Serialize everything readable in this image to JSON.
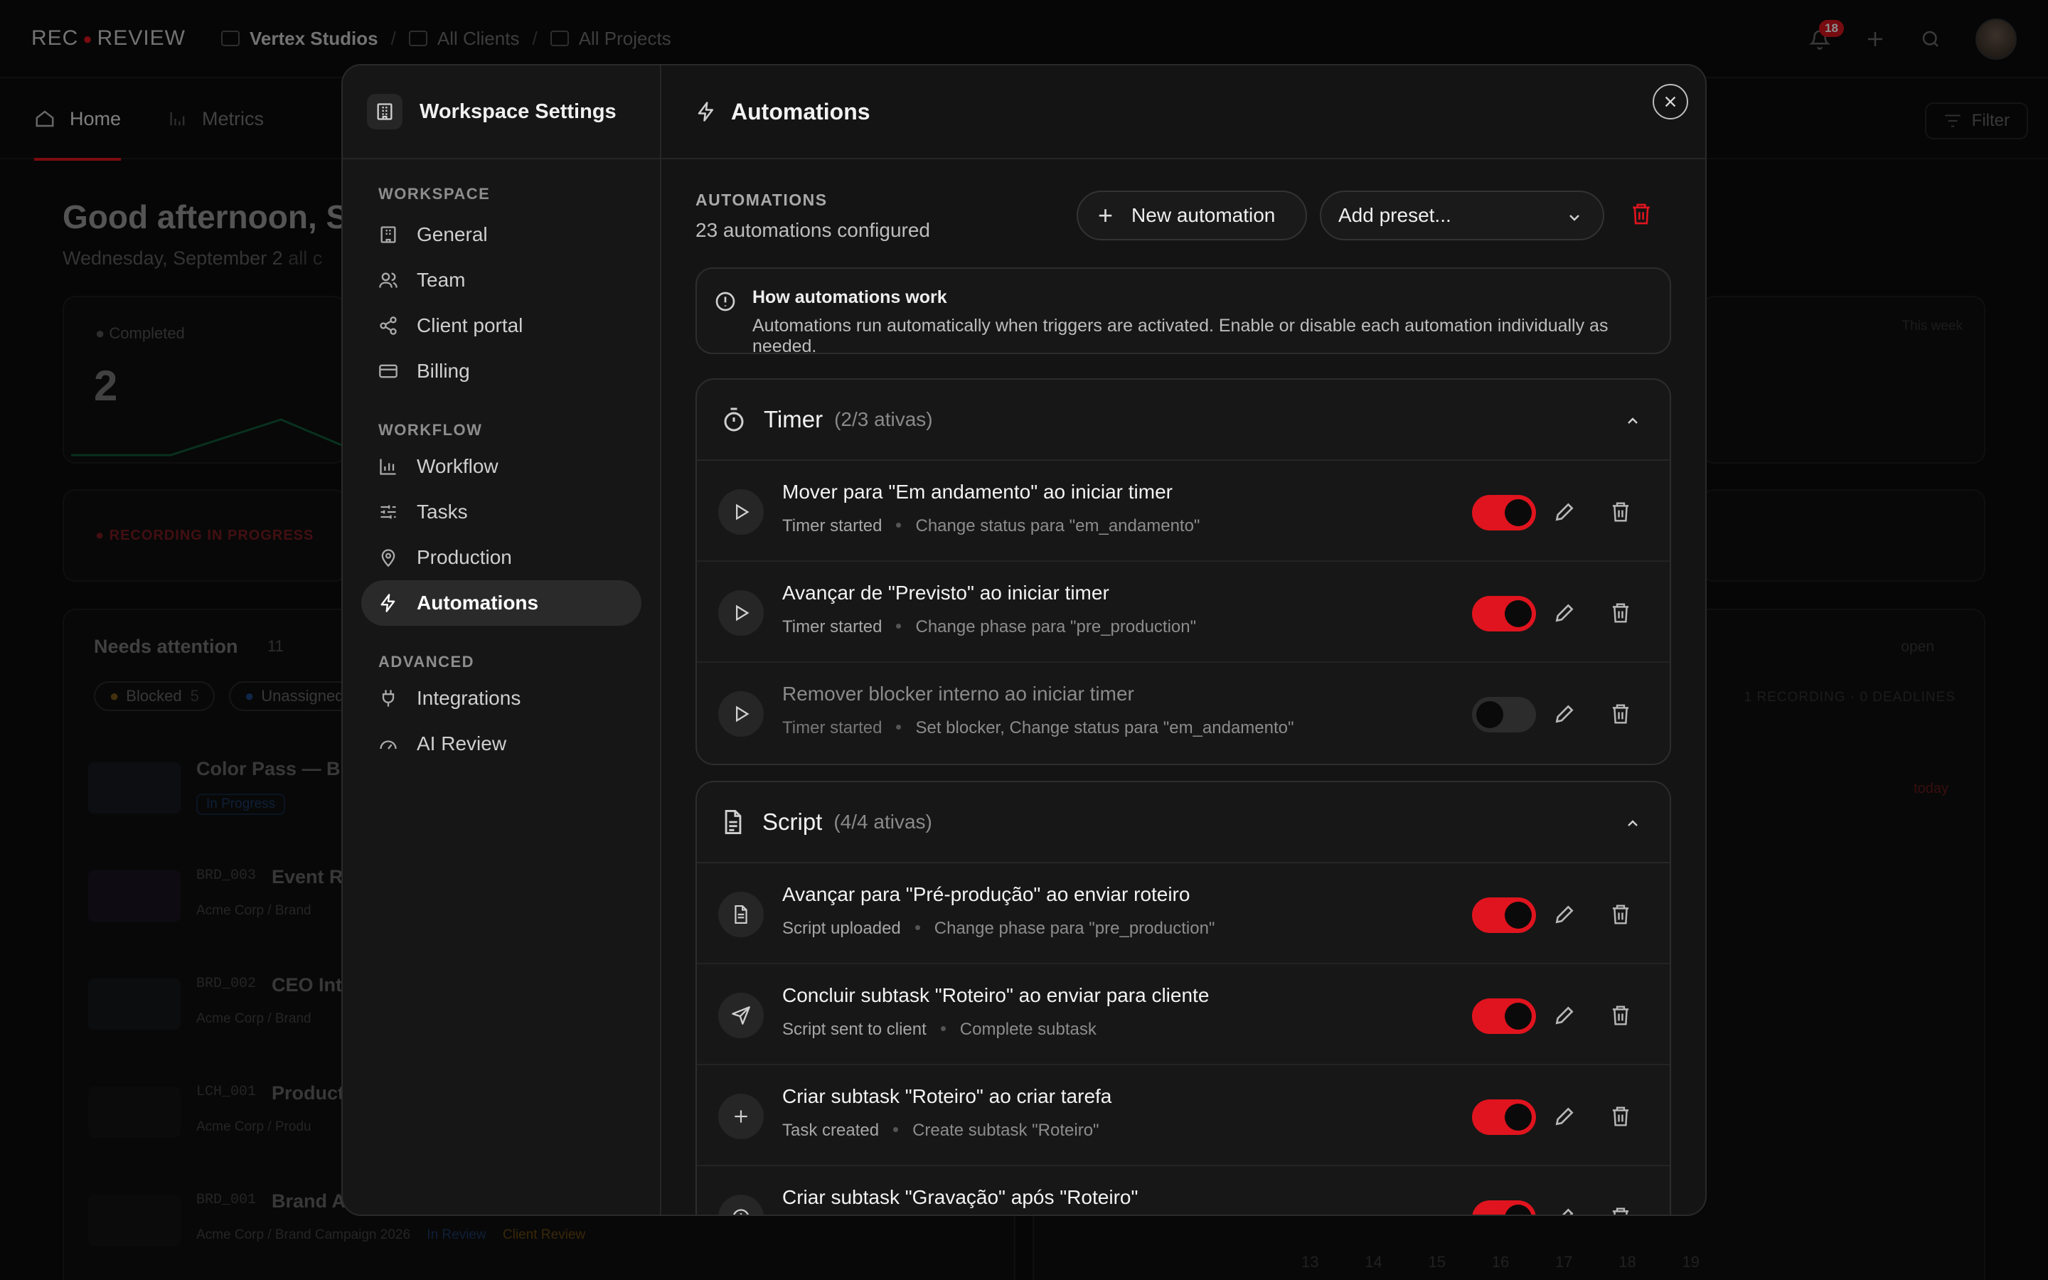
{
  "app": {
    "logo_left": "REC",
    "logo_right": "REVIEW",
    "breadcrumb": [
      "Vertex Studios",
      "All Clients",
      "All Projects"
    ],
    "notifications_count": "18",
    "nav_tabs": [
      "Home",
      "Metrics"
    ],
    "filter_label": "Filter",
    "greeting": "Good afternoon, Sa",
    "date_text": "Wednesday, September 2",
    "date_suffix": "all c",
    "completed_label": "Completed",
    "completed_value": "2",
    "this_week": "This week",
    "recording_banner": "RECORDING IN PROGRESS",
    "needs_attention": "Needs attention",
    "needs_attention_count": "11",
    "chips": [
      "Blocked",
      "5",
      "Unassigned"
    ],
    "open_label": "open",
    "recordings_note": "1 RECORDING · 0 DEADLINES",
    "today": "today",
    "projects": [
      {
        "code": "",
        "title": "Color Pass — Bra",
        "tag": "In Progress"
      },
      {
        "code": "BRD_003",
        "title": "Event R",
        "client": "Acme Corp",
        "project": "Brand"
      },
      {
        "code": "BRD_002",
        "title": "CEO Int",
        "client": "Acme Corp",
        "project": "Brand"
      },
      {
        "code": "LCH_001",
        "title": "Product",
        "client": "Acme Corp",
        "project": "Produ"
      },
      {
        "code": "BRD_001",
        "title": "Brand A",
        "client": "Acme Corp",
        "project": "Brand Campaign 2026",
        "status": "In Review",
        "review": "Client Review"
      }
    ],
    "calendar_days": [
      "13",
      "14",
      "15",
      "16",
      "17",
      "18",
      "19"
    ]
  },
  "modal": {
    "sidebar_title": "Workspace Settings",
    "sections": [
      {
        "title": "WORKSPACE",
        "items": [
          "General",
          "Team",
          "Client portal",
          "Billing"
        ]
      },
      {
        "title": "WORKFLOW",
        "items": [
          "Workflow",
          "Tasks",
          "Production",
          "Automations"
        ]
      },
      {
        "title": "ADVANCED",
        "items": [
          "Integrations",
          "AI Review"
        ]
      }
    ],
    "active_item": "Automations",
    "header_title": "Automations",
    "automations_label": "AUTOMATIONS",
    "automations_count": "23 automations configured",
    "new_button": "New automation",
    "preset_placeholder": "Add preset...",
    "info_title": "How automations work",
    "info_text": "Automations run automatically when triggers are activated. Enable or disable each automation individually as needed.",
    "groups": [
      {
        "name": "Timer",
        "count": "(2/3 ativas)",
        "icon": "stopwatch-icon",
        "rows": [
          {
            "title": "Mover para \"Em andamento\" ao iniciar timer",
            "trigger": "Timer started",
            "action": "Change status para \"em_andamento\"",
            "enabled": true,
            "icon": "play-icon"
          },
          {
            "title": "Avançar de \"Previsto\" ao iniciar timer",
            "trigger": "Timer started",
            "action": "Change phase para \"pre_production\"",
            "enabled": true,
            "icon": "play-icon"
          },
          {
            "title": "Remover blocker interno ao iniciar timer",
            "trigger": "Timer started",
            "action": "Set blocker, Change status para \"em_andamento\"",
            "enabled": false,
            "icon": "play-icon"
          }
        ]
      },
      {
        "name": "Script",
        "count": "(4/4 ativas)",
        "icon": "document-icon",
        "rows": [
          {
            "title": "Avançar para \"Pré-produção\" ao enviar roteiro",
            "trigger": "Script uploaded",
            "action": "Change phase para \"pre_production\"",
            "enabled": true,
            "icon": "document-icon"
          },
          {
            "title": "Concluir subtask \"Roteiro\" ao enviar para cliente",
            "trigger": "Script sent to client",
            "action": "Complete subtask",
            "enabled": true,
            "icon": "send-icon"
          },
          {
            "title": "Criar subtask \"Roteiro\" ao criar tarefa",
            "trigger": "Task created",
            "action": "Create subtask \"Roteiro\"",
            "enabled": true,
            "icon": "plus-icon"
          },
          {
            "title": "Criar subtask \"Gravação\" após \"Roteiro\"",
            "trigger": "",
            "action": "",
            "enabled": true,
            "icon": "clock-icon"
          }
        ]
      }
    ],
    "colors": {
      "accent": "#e0141e",
      "surface": "#171717",
      "border": "#2d2d2d"
    }
  }
}
